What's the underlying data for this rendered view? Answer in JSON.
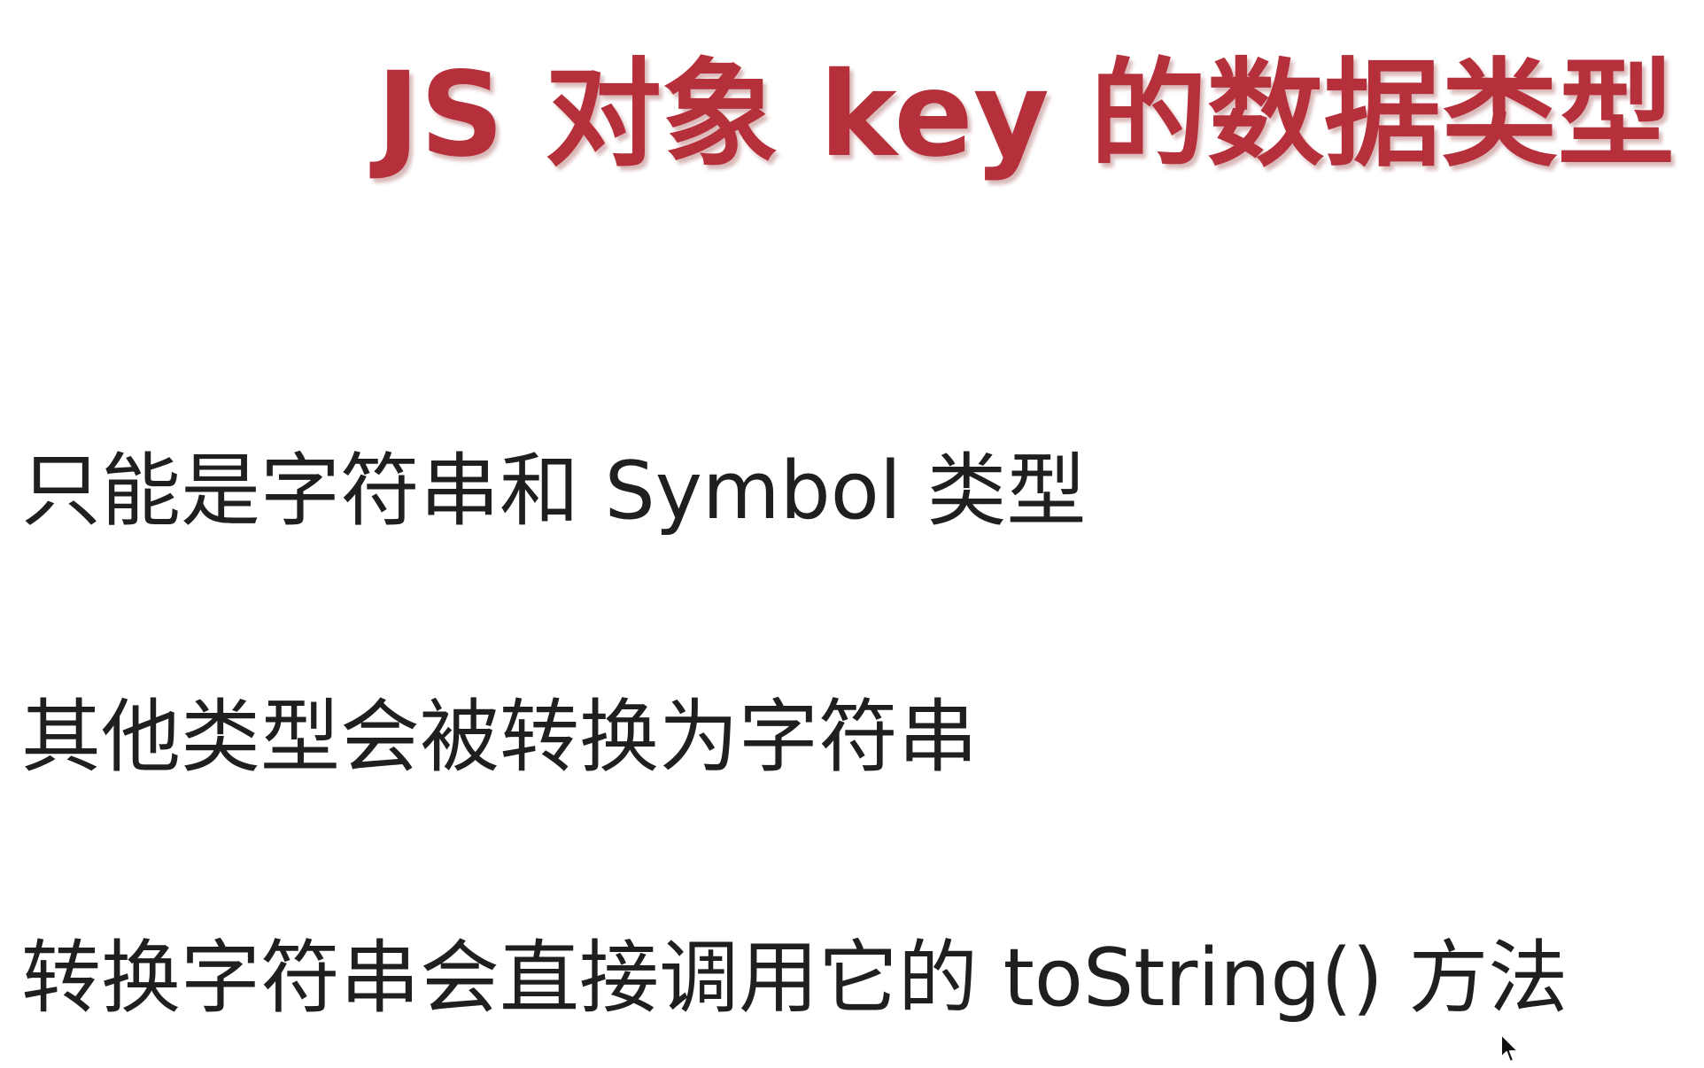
{
  "slide": {
    "title": "JS 对象 key 的数据类型",
    "bullets": [
      "只能是字符串和 Symbol 类型",
      "其他类型会被转换为字符串",
      "转换字符串会直接调用它的 toString() 方法"
    ]
  },
  "colors": {
    "title": "#b5303b",
    "body": "#1f1f1f",
    "background": "#ffffff"
  },
  "icons": {
    "cursor": "mouse-pointer-icon"
  }
}
